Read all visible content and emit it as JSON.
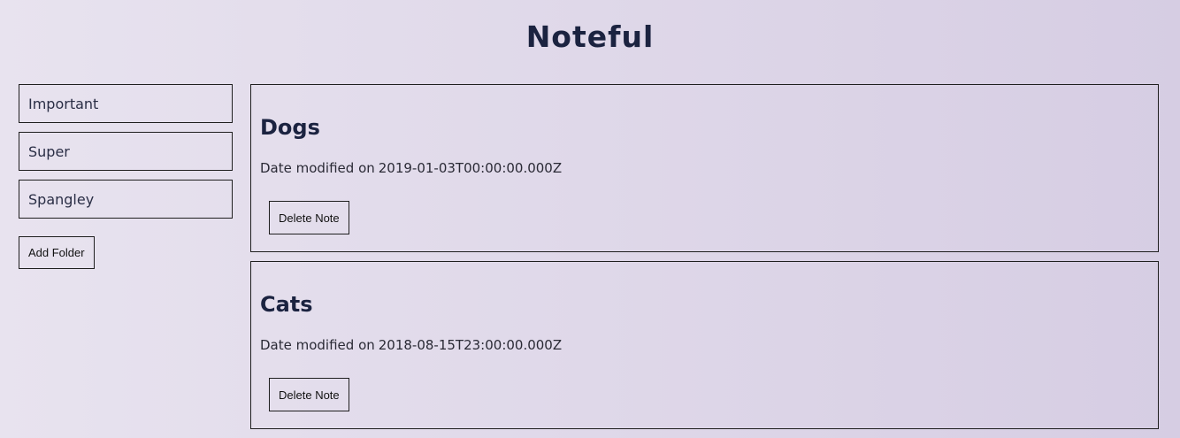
{
  "header": {
    "title": "Noteful"
  },
  "sidebar": {
    "folders": [
      {
        "label": "Important"
      },
      {
        "label": "Super"
      },
      {
        "label": "Spangley"
      }
    ],
    "add_folder_label": "Add Folder"
  },
  "notes": [
    {
      "title": "Dogs",
      "date_prefix": "Date modified on",
      "date": "2019-01-03T00:00:00.000Z",
      "delete_label": "Delete Note"
    },
    {
      "title": "Cats",
      "date_prefix": "Date modified on",
      "date": "2018-08-15T23:00:00.000Z",
      "delete_label": "Delete Note"
    }
  ],
  "colors": {
    "title": "#1b2340",
    "border": "#1f1f1f",
    "background_start": "#e8e3ef",
    "background_end": "#d6cde3"
  }
}
